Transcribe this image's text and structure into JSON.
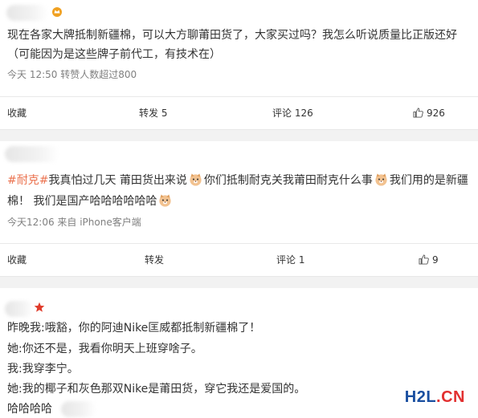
{
  "posts": [
    {
      "text_lines": [
        "现在各家大牌抵制新疆棉，可以大方聊莆田货了，大家买过吗？我怎么听说质量比正版还好",
        "（可能因为是这些牌子前代工，有技术在）"
      ],
      "meta": "今天 12:50  转赞人数超过800",
      "actions": {
        "favorite": "收藏",
        "repost": "转发 5",
        "comment": "评论 126",
        "like": "926"
      }
    },
    {
      "hashtag": "#耐克#",
      "seg1": "我真怕过几天 莆田货出来说",
      "seg2": "你们抵制耐克关我莆田耐克什么事",
      "seg3": "我们用的是新疆",
      "line2": "棉！ 我们是国产哈哈哈哈哈哈",
      "meta": "今天12:06  来自 iPhone客户端",
      "actions": {
        "favorite": "收藏",
        "repost": "转发",
        "comment": "评论 1",
        "like": "9"
      }
    },
    {
      "lines": [
        "昨晚我:哦豁，你的阿迪Nike匡威都抵制新疆棉了！",
        "她:你还不是，我看你明天上班穿啥子。",
        "我:我穿李宁。",
        "她:我的椰子和灰色那双Nike是莆田货，穿它我还是爱国的。",
        "哈哈哈哈"
      ]
    }
  ],
  "watermark": {
    "part1": "H2L",
    "part2": ".CN"
  },
  "colors": {
    "hashtag": "#eb7350",
    "watermark_blue": "#1a4fa0",
    "watermark_red": "#e23030",
    "gap": "#f2f2f2"
  }
}
